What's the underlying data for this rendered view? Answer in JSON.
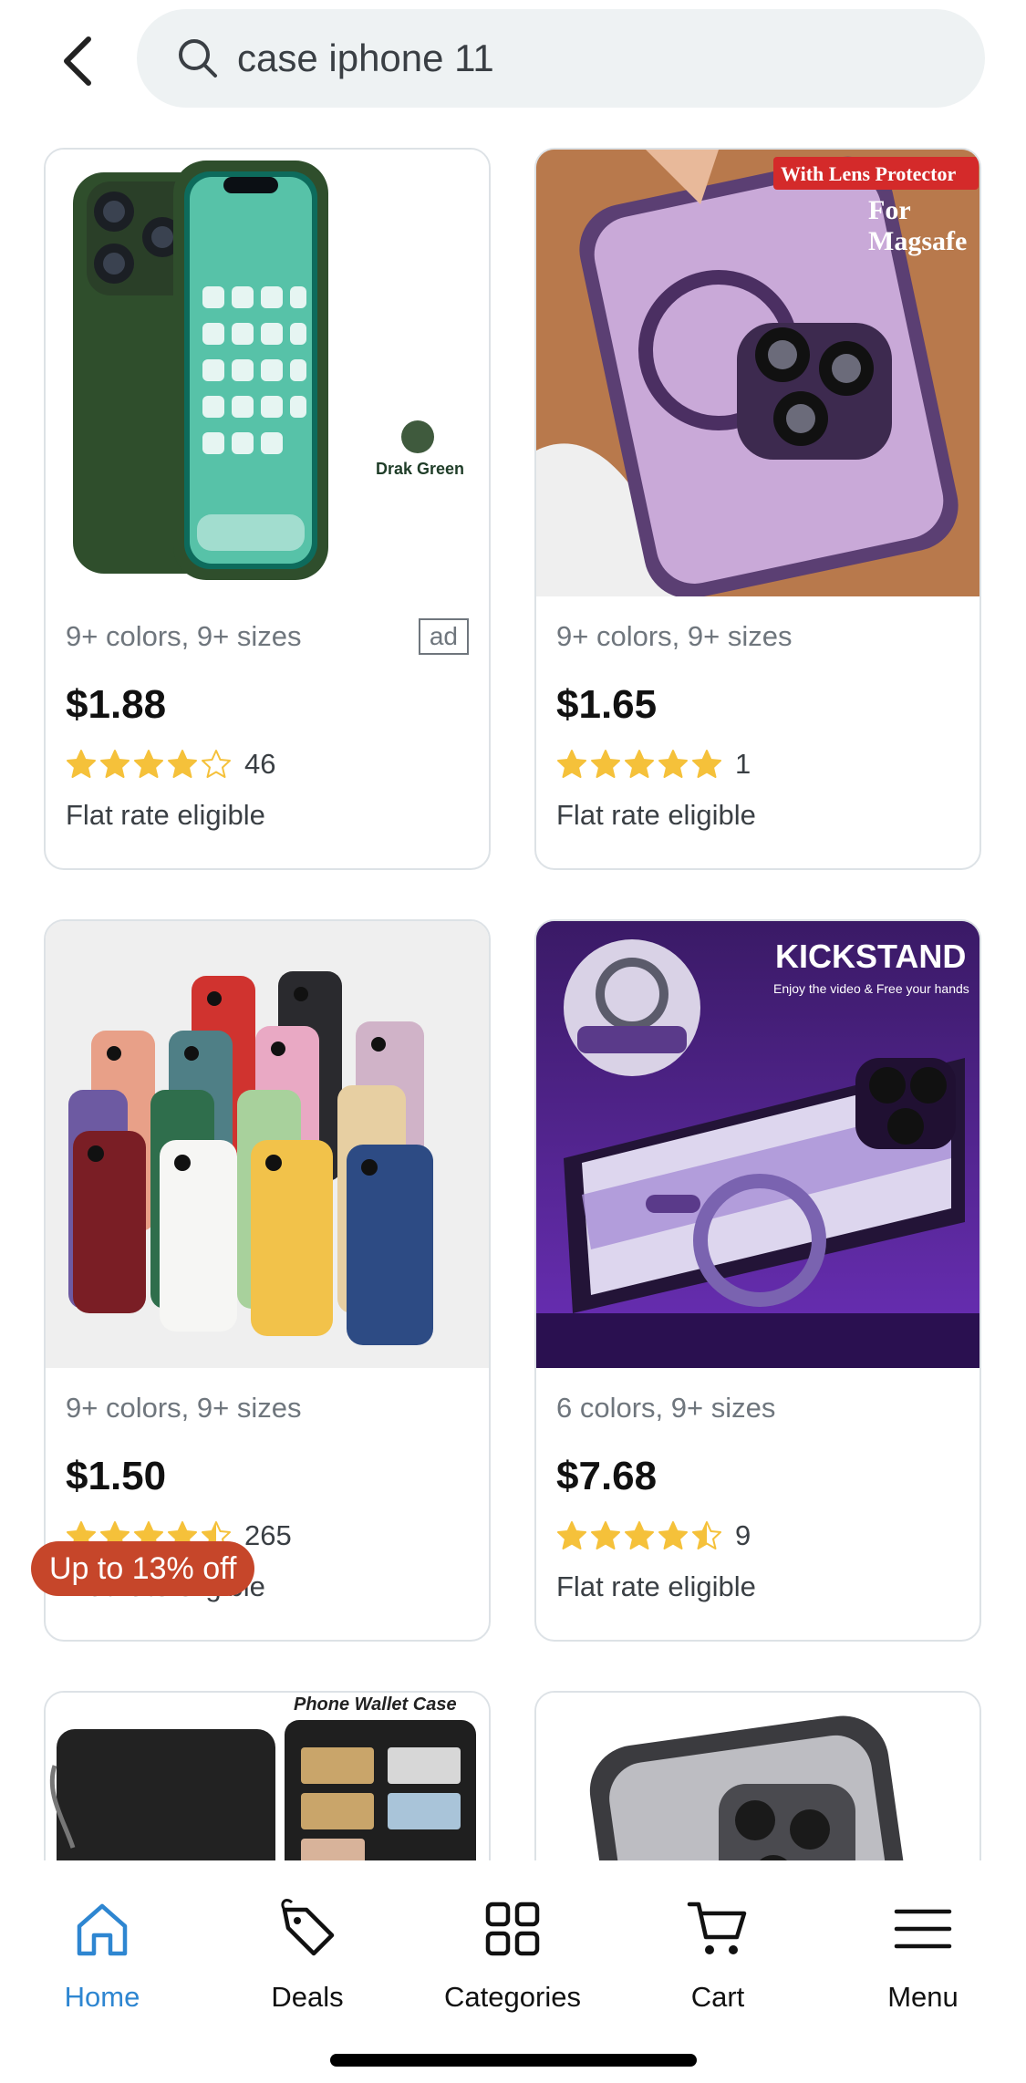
{
  "header": {
    "back_icon": "chevron-left-icon",
    "search_icon": "search-icon",
    "search_query": "case iphone 11"
  },
  "products": [
    {
      "variants": "9+ colors, 9+ sizes",
      "ad": "ad",
      "price": "$1.88",
      "stars": 4,
      "reviews": "46",
      "shipping": "Flat rate eligible",
      "image_label": "Drak Green"
    },
    {
      "variants": "9+ colors, 9+ sizes",
      "price": "$1.65",
      "stars": 5,
      "reviews": "1",
      "shipping": "Flat rate eligible",
      "image_label_1": "With Lens Protector",
      "image_label_2": "For",
      "image_label_3": "Magsafe"
    },
    {
      "variants": "9+ colors, 9+ sizes",
      "price": "$1.50",
      "stars": 4.5,
      "reviews": "265",
      "shipping": "Flat rate eligible"
    },
    {
      "variants": "6 colors, 9+ sizes",
      "price": "$7.68",
      "stars": 4.5,
      "reviews": "9",
      "shipping": "Flat rate eligible",
      "image_label_1": "KICKSTAND",
      "image_label_2": "Enjoy the video & Free your hands"
    },
    {
      "badge": "Up to 13% off",
      "image_label": "Phone Wallet Case"
    },
    {}
  ],
  "nav": [
    {
      "label": "Home",
      "icon": "home-icon",
      "active": true
    },
    {
      "label": "Deals",
      "icon": "tag-icon"
    },
    {
      "label": "Categories",
      "icon": "grid-icon"
    },
    {
      "label": "Cart",
      "icon": "cart-icon"
    },
    {
      "label": "Menu",
      "icon": "menu-icon"
    }
  ],
  "colors": {
    "accent": "#2e86d1",
    "star": "#f5c13a",
    "badge": "#c6462a",
    "search_bg": "#eef2f3"
  }
}
